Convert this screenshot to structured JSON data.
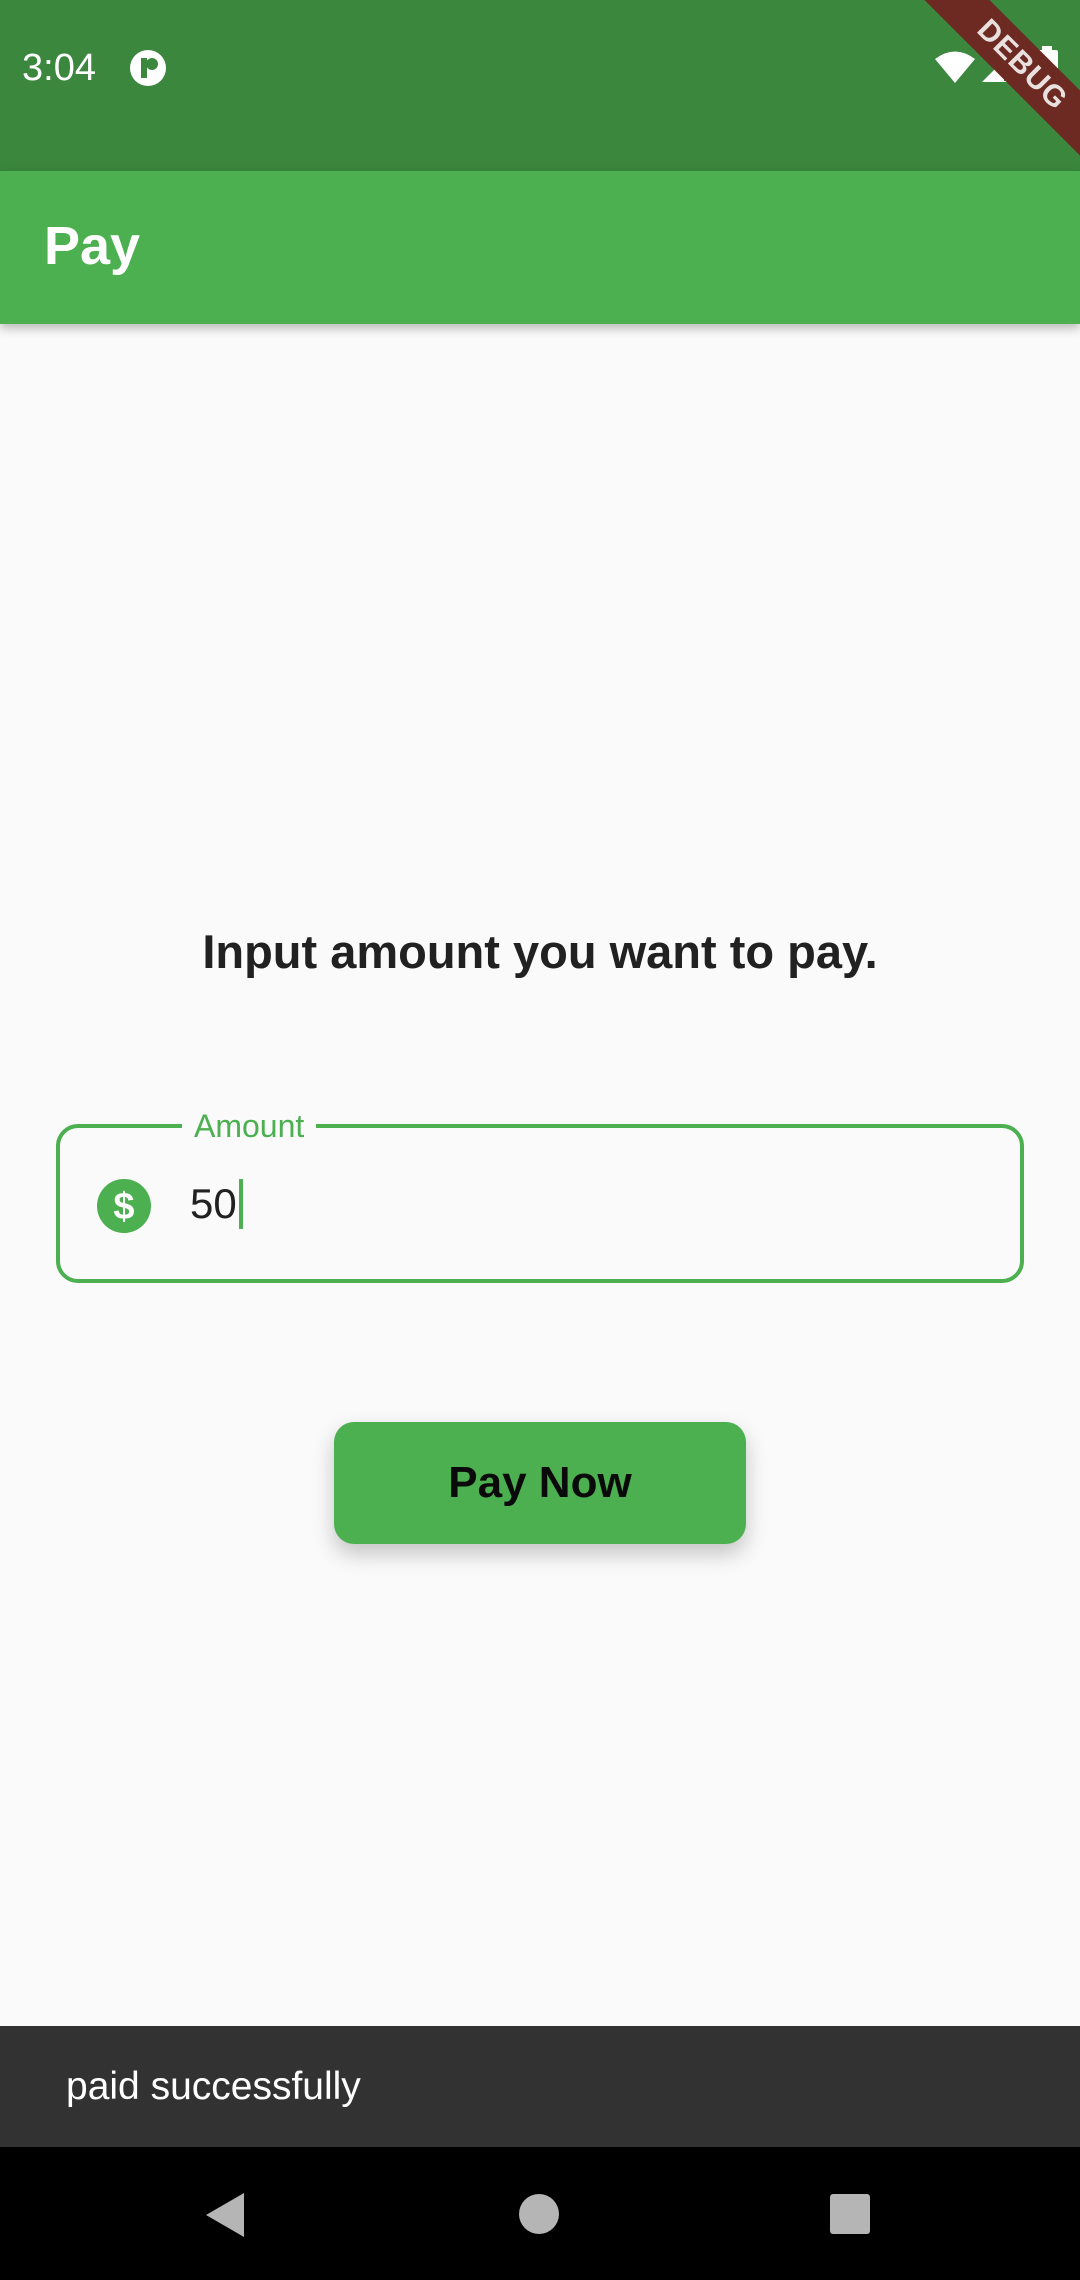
{
  "status_bar": {
    "time": "3:04",
    "app_icon": "app-notification-icon",
    "wifi_icon": "wifi-icon",
    "signal_icon": "cell-signal-icon",
    "battery_icon": "battery-icon",
    "background_color": "#3b873e"
  },
  "debug_banner": {
    "label": "DEBUG",
    "color": "#6d2a22"
  },
  "app_bar": {
    "title": "Pay",
    "color": "#4caf50"
  },
  "main": {
    "prompt": "Input amount you want to pay.",
    "amount_field": {
      "label": "Amount",
      "value": "50",
      "icon": "dollar-icon",
      "accent_color": "#4caf50"
    },
    "pay_button": {
      "label": "Pay Now"
    }
  },
  "snackbar": {
    "message": "paid successfully"
  },
  "nav_bar": {
    "back_icon": "back-triangle-icon",
    "home_icon": "home-circle-icon",
    "recents_icon": "recents-square-icon"
  }
}
